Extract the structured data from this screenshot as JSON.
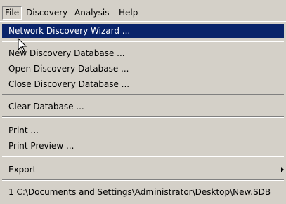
{
  "menubar": {
    "items": [
      "File",
      "Discovery",
      "Analysis",
      "Help"
    ],
    "open_index": 0
  },
  "file_menu": {
    "network_wizard": "Network Discovery Wizard ...",
    "new_db": "New Discovery Database ...",
    "open_db": "Open Discovery Database ...",
    "close_db": "Close Discovery Database ...",
    "clear_db": "Clear Database ...",
    "print": "Print ...",
    "print_preview": "Print Preview ...",
    "export": "Export",
    "recent_1": "1 C:\\Documents and Settings\\Administrator\\Desktop\\New.SDB"
  },
  "colors": {
    "menu_bg": "#d4d0c8",
    "highlight_bg": "#0a246a",
    "highlight_text": "#ffffff"
  },
  "icons": {
    "submenu": "chevron-right-icon",
    "cursor": "mouse-pointer-icon"
  }
}
